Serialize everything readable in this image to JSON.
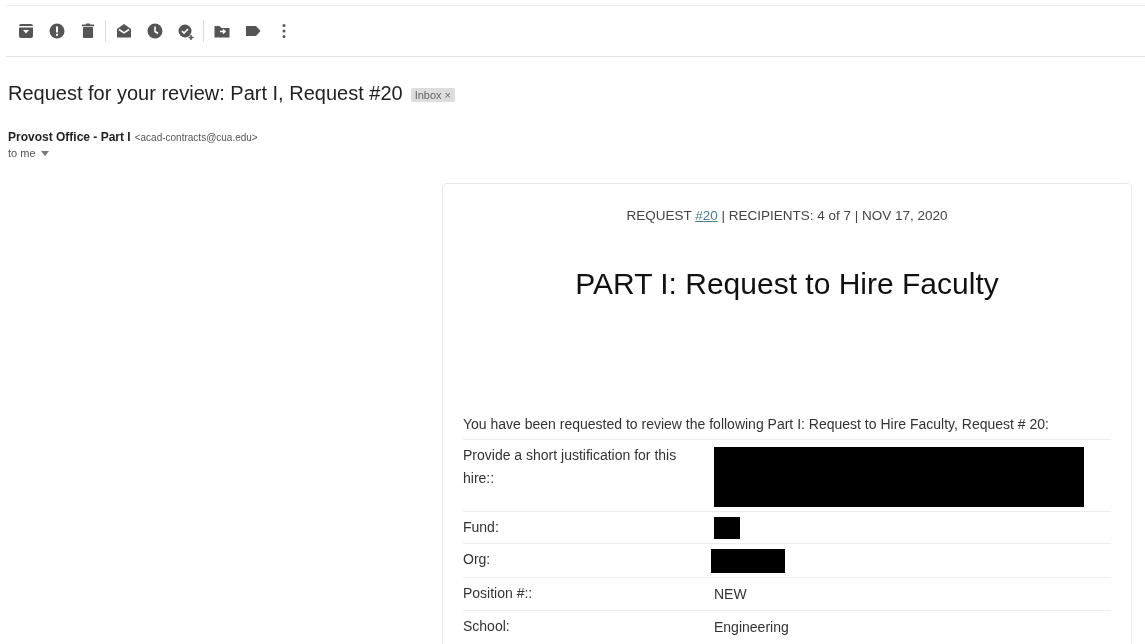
{
  "message": {
    "subject": "Request for your review: Part I, Request #20",
    "label_chip": "Inbox ×",
    "sender_name": "Provost Office - Part I",
    "sender_email": "<acad-contracts@cua.edu>",
    "recipient": "to me"
  },
  "card": {
    "meta_before": "REQUEST",
    "meta_link": "#20",
    "meta_after": "| RECIPIENTS: 4 of 7 | NOV 17, 2020",
    "title": "PART I: Request to Hire Faculty",
    "intro": "You have been requested to review the following Part I: Request to Hire Faculty, Request # 20:",
    "rows": [
      {
        "label": "Provide a short justification for this hire::",
        "value": {
          "kind": "redacted"
        }
      },
      {
        "label": "Fund:",
        "value": {
          "kind": "redacted"
        }
      },
      {
        "label": "Org:",
        "value": {
          "kind": "redacted"
        }
      },
      {
        "label": "Position #::",
        "value": {
          "kind": "text",
          "text": "NEW"
        }
      },
      {
        "label": "School:",
        "value": {
          "kind": "text",
          "text": "Engineering"
        }
      }
    ]
  }
}
